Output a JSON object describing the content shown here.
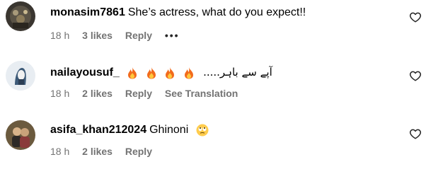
{
  "comments": [
    {
      "username": "monasim7861",
      "text": "She’s actress, what do you expect!!",
      "time": "18 h",
      "likes": "3 likes",
      "reply": "Reply",
      "more": "•••",
      "avatar_icon": "profile-photo-dark-icon",
      "accent": "#000000"
    },
    {
      "username": "nailayousuf_",
      "text": "آپے سے باہر.....",
      "emojis": [
        "fire",
        "fire",
        "fire",
        "fire"
      ],
      "time": "18 h",
      "likes": "2 likes",
      "reply": "Reply",
      "see_translation": "See Translation",
      "avatar_icon": "profile-photo-light-icon"
    },
    {
      "username": "asifa_khan212024",
      "text": "Ghinoni",
      "emojis": [
        "face-with-rolling-eyes"
      ],
      "time": "18 h",
      "likes": "2 likes",
      "reply": "Reply",
      "avatar_icon": "profile-photo-couple-icon"
    }
  ],
  "colors": {
    "text": "#000000",
    "meta": "#737373",
    "fire_orange": "#f26b1d",
    "fire_yellow": "#ffc83d"
  }
}
